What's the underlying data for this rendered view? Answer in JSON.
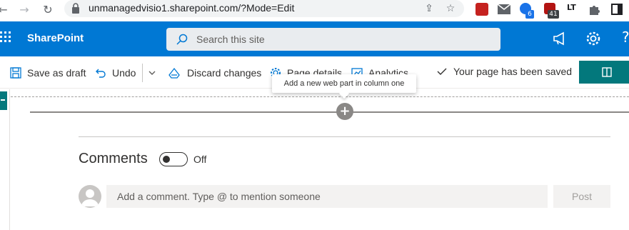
{
  "browser": {
    "url": "unmanagedvisio1.sharepoint.com/?Mode=Edit",
    "ext_badge_1": "6",
    "ext_badge_2": "41",
    "ext_lt": "LT"
  },
  "suite": {
    "app_name": "SharePoint",
    "search_placeholder": "Search this site"
  },
  "commands": {
    "save_as_draft": "Save as draft",
    "undo": "Undo",
    "discard_changes": "Discard changes",
    "page_details": "Page details",
    "analytics": "Analytics",
    "saved_status": "Your page has been saved"
  },
  "canvas": {
    "tooltip": "Add a new web part in column one",
    "add_symbol": "+"
  },
  "comments": {
    "title": "Comments",
    "toggle_state": "Off",
    "input_placeholder": "Add a comment. Type @ to mention someone",
    "post_label": "Post"
  },
  "colors": {
    "suite_blue": "#0078d4",
    "teal": "#03787c"
  }
}
